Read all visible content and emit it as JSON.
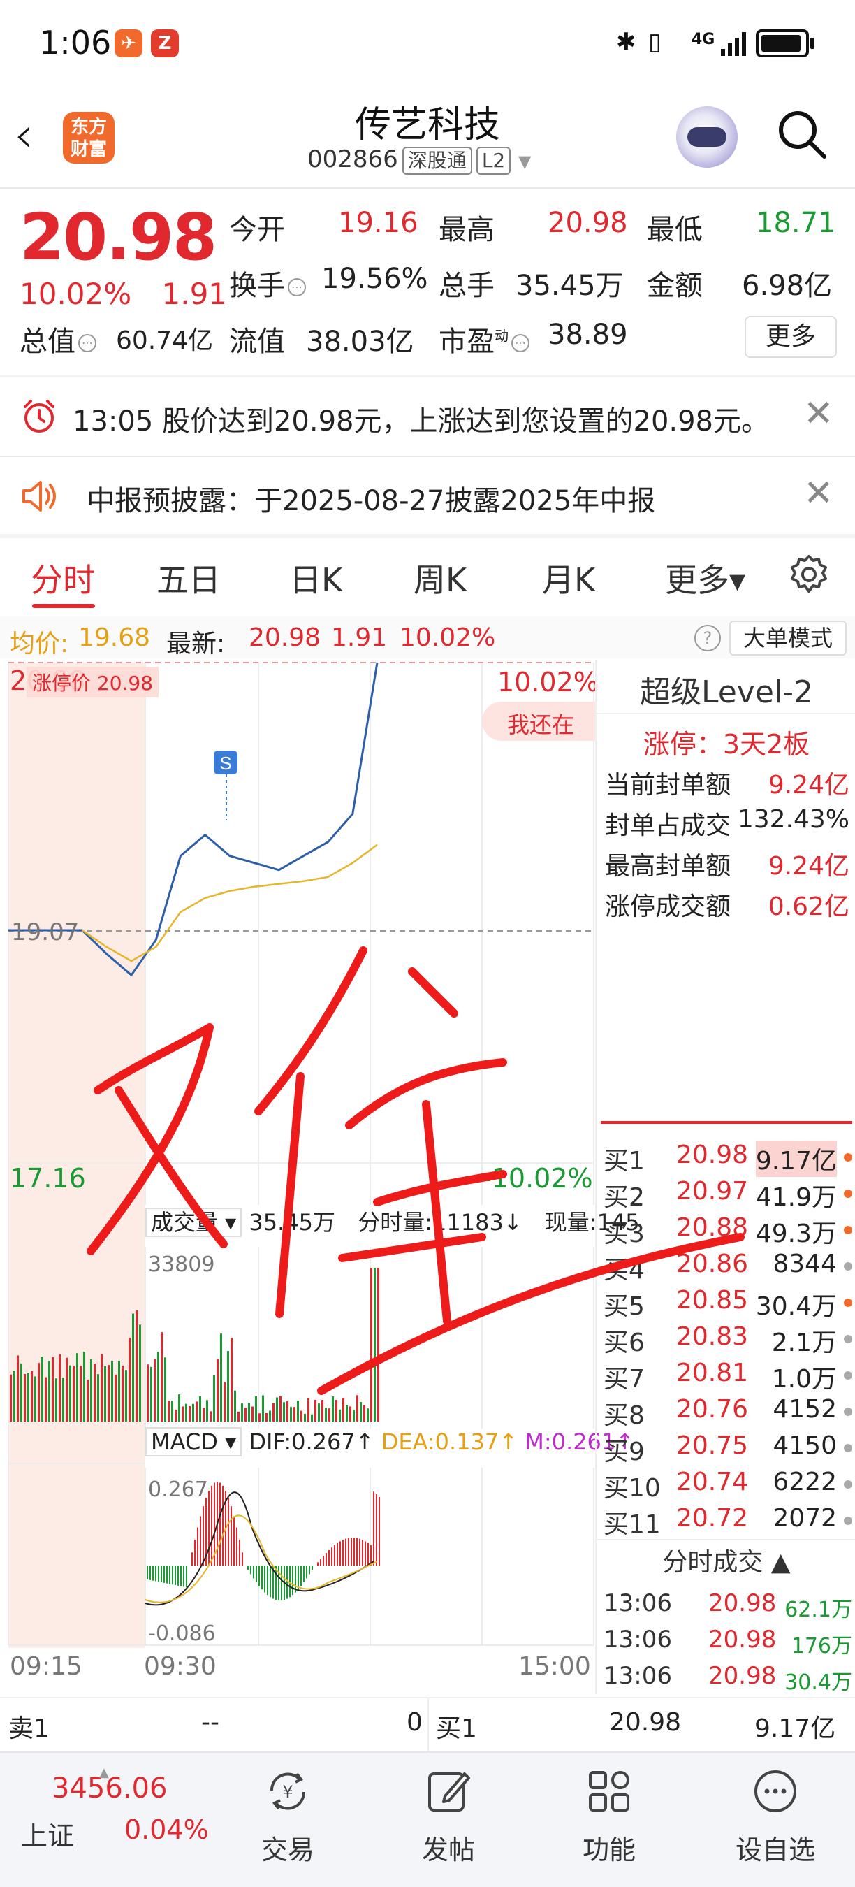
{
  "status_bar": {
    "time": "1:06",
    "network": "4G"
  },
  "header": {
    "back_icon": "chevron-left-icon",
    "app_logo_text": "东方财富",
    "stock_name": "传艺科技",
    "stock_code": "002866",
    "tag1": "深股通",
    "tag2": "L2",
    "search_icon": "search-icon"
  },
  "quote": {
    "price": "20.98",
    "change_pct": "10.02%",
    "change_amt": "1.91",
    "open_label": "今开",
    "open": "19.16",
    "high_label": "最高",
    "high": "20.98",
    "low_label": "最低",
    "low": "18.71",
    "turnover_label": "换手",
    "turnover": "19.56%",
    "volume_label": "总手",
    "volume": "35.45万",
    "amount_label": "金额",
    "amount": "6.98亿",
    "mktcap_label": "总值",
    "mktcap": "60.74亿",
    "float_label": "流值",
    "float": "38.03亿",
    "pe_label": "市盈",
    "pe_sup": "动",
    "pe": "38.89",
    "more_label": "更多"
  },
  "notices": [
    {
      "icon": "alarm-clock-icon",
      "text": "13:05 股价达到20.98元，上涨达到您设置的20.98元。"
    },
    {
      "icon": "speaker-icon",
      "text": "中报预披露：于2025-08-27披露2025年中报"
    }
  ],
  "tabs": [
    {
      "label": "分时",
      "active": true
    },
    {
      "label": "五日"
    },
    {
      "label": "日K"
    },
    {
      "label": "周K"
    },
    {
      "label": "月K"
    },
    {
      "label": "更多▾"
    }
  ],
  "avg_row": {
    "avg_label": "均价:",
    "avg": "19.68",
    "latest_label": "最新:",
    "latest": "20.98",
    "chg": "1.91",
    "pct": "10.02%",
    "big_order_mode": "大单模式"
  },
  "chart_labels": {
    "top_price": "20.98",
    "limit_tag": "涨停价 20.98",
    "top_pct": "10.02%",
    "mid_price": "19.07",
    "bottom_price": "17.16",
    "bottom_pct": "-10.02%",
    "ghost_text": "我还在",
    "volume_title": "成交量 ▾",
    "volume_total": "35.45万",
    "volume_min": "分时量:11183↓",
    "volume_now": "现量:145",
    "volume_max": "33809",
    "macd_title": "MACD ▾",
    "dif": "DIF:0.267↑",
    "dea": "DEA:0.137↑",
    "m": "M:0.261↑",
    "macd_top": "0.267",
    "macd_bottom": "-0.086",
    "time_start": "09:15",
    "time_open": "09:30",
    "time_end": "15:00",
    "s_marker": "S"
  },
  "chart_data": {
    "type": "line",
    "x": [
      "09:15",
      "09:20",
      "09:25",
      "09:30",
      "09:40",
      "09:50",
      "10:00",
      "10:10",
      "10:20",
      "10:30",
      "10:45",
      "11:00",
      "11:15",
      "11:30",
      "13:00",
      "13:05"
    ],
    "series": [
      {
        "values": [
          19.07,
          19.07,
          19.07,
          19.07,
          18.9,
          18.75,
          19.0,
          19.6,
          19.75,
          19.6,
          19.55,
          19.5,
          19.6,
          19.7,
          19.9,
          20.98
        ]
      },
      {
        "values": [
          null,
          null,
          null,
          19.07,
          18.95,
          18.85,
          18.95,
          19.2,
          19.3,
          19.35,
          19.38,
          19.4,
          19.42,
          19.45,
          19.55,
          19.68
        ]
      }
    ],
    "ylim": [
      17.16,
      20.98
    ],
    "y_ref": 19.07
  },
  "right_panel": {
    "title": "超级Level-2",
    "limit_up": "涨停：3天2板",
    "stats": [
      {
        "k": "当前封单额",
        "v": "9.24亿",
        "red": true
      },
      {
        "k": "封单占成交",
        "v": "132.43%",
        "red": false
      },
      {
        "k": "最高封单额",
        "v": "9.24亿",
        "red": true
      },
      {
        "k": "涨停成交额",
        "v": "0.62亿",
        "red": true
      }
    ],
    "bids": [
      {
        "l": "买1",
        "p": "20.98",
        "q": "9.17亿",
        "dot": "o"
      },
      {
        "l": "买2",
        "p": "20.97",
        "q": "41.9万",
        "dot": "o"
      },
      {
        "l": "买3",
        "p": "20.88",
        "q": "49.3万",
        "dot": "o"
      },
      {
        "l": "买4",
        "p": "20.86",
        "q": "8344",
        "dot": "g"
      },
      {
        "l": "买5",
        "p": "20.85",
        "q": "30.4万",
        "dot": "o"
      },
      {
        "l": "买6",
        "p": "20.83",
        "q": "2.1万",
        "dot": "g"
      },
      {
        "l": "买7",
        "p": "20.81",
        "q": "1.0万",
        "dot": "g"
      },
      {
        "l": "买8",
        "p": "20.76",
        "q": "4152",
        "dot": "g"
      },
      {
        "l": "买9",
        "p": "20.75",
        "q": "4150",
        "dot": "g"
      },
      {
        "l": "买10",
        "p": "20.74",
        "q": "6222",
        "dot": "g"
      },
      {
        "l": "买11",
        "p": "20.72",
        "q": "2072",
        "dot": "g"
      }
    ],
    "trades_title": "分时成交 ▲",
    "trades": [
      {
        "t": "13:06",
        "p": "20.98",
        "v": "62.1万"
      },
      {
        "t": "13:06",
        "p": "20.98",
        "v": "176万"
      },
      {
        "t": "13:06",
        "p": "20.98",
        "v": "30.4万"
      }
    ]
  },
  "sell_bar": {
    "sell1_label": "卖1",
    "sell1_price": "--",
    "sell1_qty": "0",
    "buy1_label": "买1",
    "buy1_price": "20.98",
    "buy1_qty": "9.17亿"
  },
  "bottom_nav": {
    "index_value": "3456.06",
    "index_name": "上证",
    "index_pct": "0.04%",
    "items": [
      {
        "label": "交易",
        "icon": "trade-icon"
      },
      {
        "label": "发帖",
        "icon": "edit-icon"
      },
      {
        "label": "功能",
        "icon": "grid-icon"
      },
      {
        "label": "设自选",
        "icon": "more-icon"
      }
    ]
  },
  "colors": {
    "up": "#e0282e",
    "down": "#1a9a32",
    "price_line": "#2d5fa8",
    "avg_line": "#e7b52a",
    "accent": "#f26a2b"
  }
}
